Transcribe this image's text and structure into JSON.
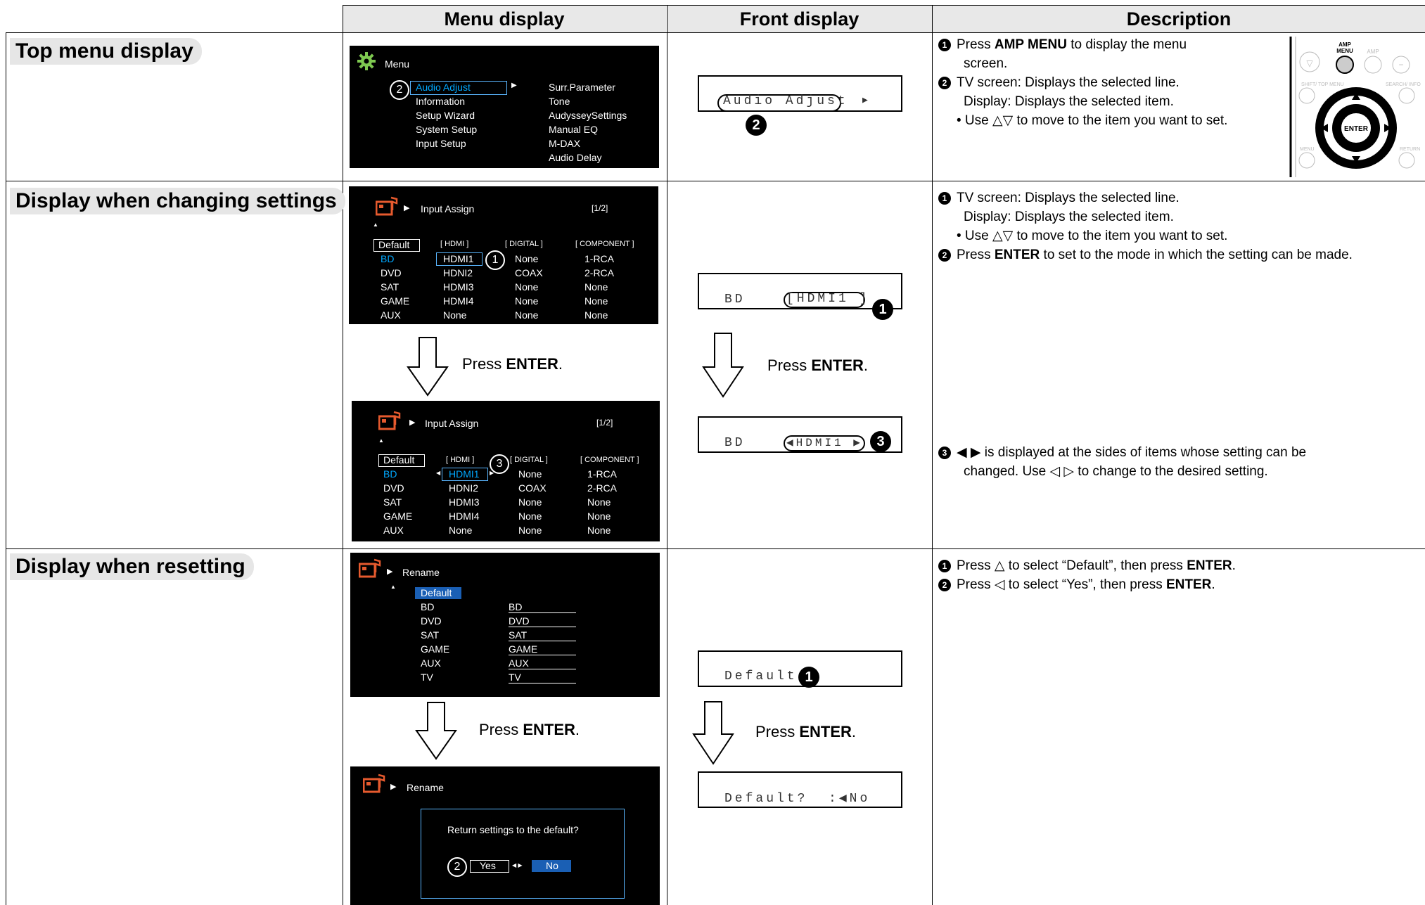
{
  "headers": {
    "menu_display": "Menu display",
    "front_display": "Front display",
    "description": "Description"
  },
  "rows": {
    "top": {
      "title": "Top menu display",
      "tv": {
        "menu_title": "Menu",
        "left_items": [
          "Audio Adjust",
          "Information",
          "Setup Wizard",
          "System Setup",
          "Input Setup"
        ],
        "right_items": [
          "Surr.Parameter",
          "Tone",
          "AudysseySettings",
          "Manual EQ",
          "M-DAX",
          "Audio Delay"
        ],
        "callout": "2"
      },
      "front": {
        "text": "Audio Adjust",
        "callout": "2"
      },
      "desc": {
        "b1_pre": "Press ",
        "b1_bold": "AMP MENU",
        "b1_post": " to display the menu",
        "b1_cont": "screen.",
        "b2_pre": "TV screen: Displays the selected line.",
        "b2_cont": "Display: Displays the selected item.",
        "b2_sub": "• Use △▽ to move to the item you want to set."
      },
      "remote": {
        "amp_menu": "AMP\nMENU",
        "amp": "AMP",
        "shift": "SHIFT/ TOP MENU",
        "search": "SEARCH/ INFO",
        "menu": "MENU",
        "return": "RETURN",
        "enter": "ENTER"
      }
    },
    "changing": {
      "title": "Display when changing settings",
      "tv1": {
        "screen_title": "Input Assign",
        "page": "[1/2]",
        "col_default": "Default",
        "col_hdmi": "[ HDMI ]",
        "col_digital": "[ DIGITAL ]",
        "col_component": "[ COMPONENT ]",
        "rows": [
          [
            "BD",
            "HDMI1",
            "None",
            "1-RCA"
          ],
          [
            "DVD",
            "HDNI2",
            "COAX",
            "2-RCA"
          ],
          [
            "SAT",
            "HDMI3",
            "None",
            "None"
          ],
          [
            "GAME",
            "HDMI4",
            "None",
            "None"
          ],
          [
            "AUX",
            "None",
            "None",
            "None"
          ]
        ],
        "callout": "1"
      },
      "tv2": {
        "screen_title": "Input Assign",
        "page": "[1/2]",
        "col_default": "Default",
        "col_hdmi": "[ HDMI ]",
        "col_digital": "[ DIGITAL ]",
        "col_component": "[ COMPONENT ]",
        "rows": [
          [
            "BD",
            "HDMI1",
            "None",
            "1-RCA"
          ],
          [
            "DVD",
            "HDNI2",
            "COAX",
            "2-RCA"
          ],
          [
            "SAT",
            "HDMI3",
            "None",
            "None"
          ],
          [
            "GAME",
            "HDMI4",
            "None",
            "None"
          ],
          [
            "AUX",
            "None",
            "None",
            "None"
          ]
        ],
        "callout": "3"
      },
      "press_pre": "Press ",
      "press_bold": "ENTER",
      "press_post": ".",
      "front1": {
        "left": "BD",
        "value": "[HDMI1 ]",
        "callout": "1"
      },
      "front2": {
        "left": "BD",
        "value": "◀HDMI1 ▶",
        "callout": "3"
      },
      "desc": {
        "b1": "TV screen: Displays the selected line.",
        "b1_cont": "Display: Displays the selected item.",
        "b1_sub": "• Use △▽ to move to the item you want to set.",
        "b2_pre": "Press ",
        "b2_bold": "ENTER",
        "b2_post": " to set to the mode in which the setting can be made.",
        "b3": "◀ ▶ is displayed at the sides of items whose setting can be",
        "b3_cont": "changed. Use ◁ ▷ to change to the desired setting."
      }
    },
    "reset": {
      "title": "Display when resetting",
      "tv1": {
        "screen_title": "Rename",
        "items": [
          "Default",
          "BD",
          "DVD",
          "SAT",
          "GAME",
          "AUX",
          "TV"
        ],
        "values": [
          "BD",
          "DVD",
          "SAT",
          "GAME",
          "AUX",
          "TV"
        ]
      },
      "tv2": {
        "screen_title": "Rename",
        "question": "Return settings to the default?",
        "yes": "Yes",
        "no": "No",
        "callout": "2"
      },
      "press_pre": "Press ",
      "press_bold": "ENTER",
      "press_post": ".",
      "front1": {
        "text": "Default",
        "callout": "1"
      },
      "front2": {
        "text": "Default?  :◀No"
      },
      "desc": {
        "b1_pre": "Press △ to select “Default”, then press ",
        "b1_bold": "ENTER",
        "b1_post": ".",
        "b2_pre": "Press ◁ to select “Yes”, then press ",
        "b2_bold": "ENTER",
        "b2_post": "."
      }
    }
  }
}
